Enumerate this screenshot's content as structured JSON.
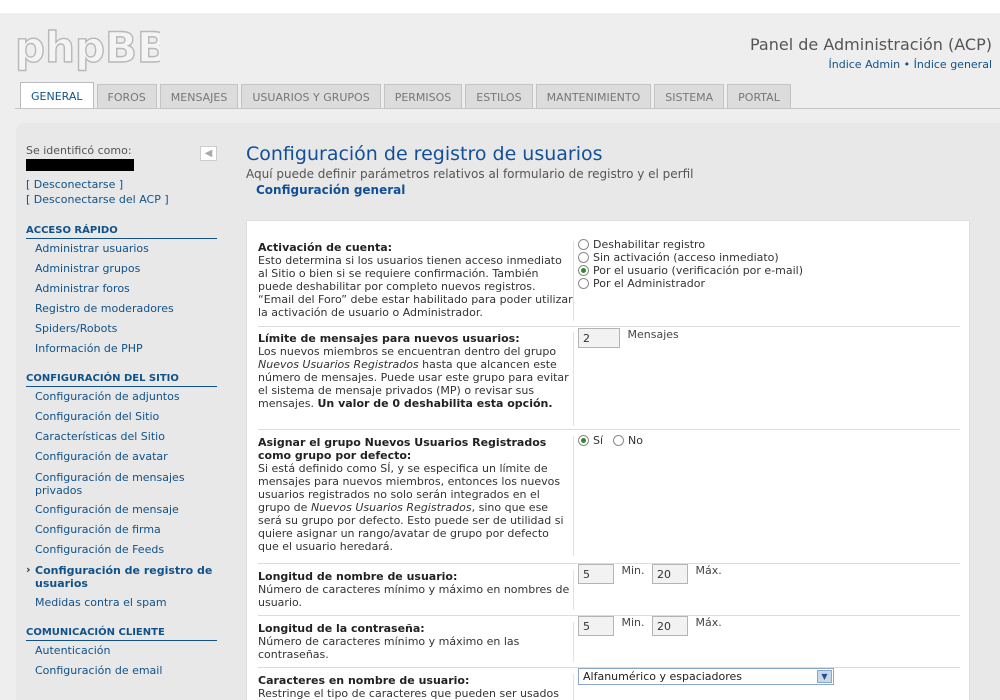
{
  "header": {
    "logo_text": "phpBB",
    "acp_title": "Panel de Administración (ACP)",
    "link_admin_index": "Índice Admin",
    "separator": "•",
    "link_general_index": "Índice general"
  },
  "tabs": [
    {
      "label": "GENERAL",
      "active": true
    },
    {
      "label": "FOROS"
    },
    {
      "label": "MENSAJES"
    },
    {
      "label": "USUARIOS Y GRUPOS"
    },
    {
      "label": "PERMISOS"
    },
    {
      "label": "ESTILOS"
    },
    {
      "label": "MANTENIMIENTO"
    },
    {
      "label": "SISTEMA"
    },
    {
      "label": "PORTAL"
    }
  ],
  "sidebar": {
    "identified_as": "Se identificó como:",
    "collapse_glyph": "◀",
    "logout": "[ Desconectarse ]",
    "logout_acp": "[ Desconectarse del ACP ]",
    "quick_access": {
      "heading": "ACCESO RÁPIDO",
      "items": [
        "Administrar usuarios",
        "Administrar grupos",
        "Administrar foros",
        "Registro de moderadores",
        "Spiders/Robots",
        "Información de PHP"
      ]
    },
    "site_config": {
      "heading": "CONFIGURACIÓN DEL SITIO",
      "items": [
        "Configuración de adjuntos",
        "Configuración del Sitio",
        "Características del Sitio",
        "Configuración de avatar",
        "Configuración de mensajes privados",
        "Configuración de mensaje",
        "Configuración de firma",
        "Configuración de Feeds",
        "Configuración de registro de usuarios",
        "Medidas contra el spam"
      ]
    },
    "client_comm": {
      "heading": "COMUNICACIÓN CLIENTE",
      "items": [
        "Autenticación",
        "Configuración de email"
      ]
    }
  },
  "main": {
    "title": "Configuración de registro de usuarios",
    "description": "Aquí puede definir parámetros relativos al formulario de registro y el perfil",
    "section": "Configuración general",
    "activation": {
      "title": "Activación de cuenta:",
      "desc": "Esto determina si los usuarios tienen acceso inmediato al Sitio o bien si se requiere confirmación. También puede deshabilitar por completo nuevos registros. “Email del Foro” debe estar habilitado para poder utilizar la activación de usuario o Administrador.",
      "options": [
        "Deshabilitar registro",
        "Sin activación (acceso inmediato)",
        "Por el usuario (verificación por e-mail)",
        "Por el Administrador"
      ],
      "selected": "Por el usuario (verificación por e-mail)"
    },
    "post_limit": {
      "title": "Límite de mensajes para nuevos usuarios:",
      "desc_1": "Los nuevos miembros se encuentran dentro del grupo ",
      "desc_italic": "Nuevos Usuarios Registrados",
      "desc_2": " hasta que alcancen este número de mensajes. Puede usar este grupo para evitar el sistema de mensaje privados (MP) o revisar sus mensajes. ",
      "desc_bold": "Un valor de 0 deshabilita esta opción.",
      "value": "2",
      "unit": "Mensajes"
    },
    "default_group": {
      "title": "Asignar el grupo Nuevos Usuarios Registrados como grupo por defecto:",
      "desc_1": "Si está definido como SÍ, y se especifica un límite de mensajes para nuevos miembros, entonces los nuevos usuarios registrados no solo serán integrados en el grupo de ",
      "desc_italic": "Nuevos Usuarios Registrados",
      "desc_2": ", sino que ese será su grupo por defecto. Esto puede ser de utilidad si quiere asignar un rango/avatar de grupo por defecto que el usuario heredará.",
      "yes": "Sí",
      "no": "No",
      "selected": "Sí"
    },
    "username_length": {
      "title": "Longitud de nombre de usuario:",
      "desc": "Número de caracteres mínimo y máximo en nombres de usuario.",
      "min": "5",
      "min_label": "Min.",
      "max": "20",
      "max_label": "Máx."
    },
    "password_length": {
      "title": "Longitud de la contraseña:",
      "desc": "Número de caracteres mínimo y máximo en las contraseñas.",
      "min": "5",
      "min_label": "Min.",
      "max": "20",
      "max_label": "Máx."
    },
    "username_chars": {
      "title": "Caracteres en nombre de usuario:",
      "desc": "Restringe el tipo de caracteres que pueden ser usados en nombres de usuario, espaciadores son: espacio, -",
      "selected": "Alfanumérico y espaciadores"
    }
  },
  "colors": {
    "link": "#105289",
    "title": "#115098",
    "radio_checked": "#2f8a2f"
  }
}
